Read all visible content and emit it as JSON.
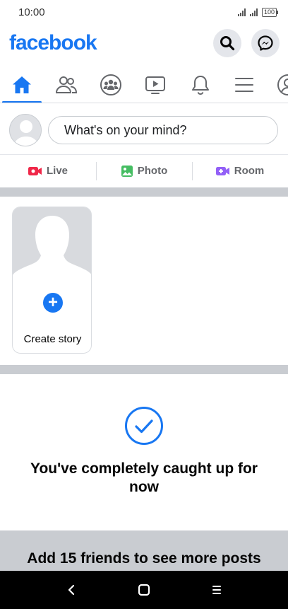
{
  "status_bar": {
    "time": "10:00",
    "battery": "100"
  },
  "header": {
    "logo": "facebook",
    "search_icon": "search-icon",
    "messenger_icon": "messenger-icon"
  },
  "nav_tabs": [
    {
      "name": "home",
      "icon": "home-icon",
      "active": true
    },
    {
      "name": "friends",
      "icon": "friends-icon",
      "active": false
    },
    {
      "name": "groups",
      "icon": "groups-icon",
      "active": false
    },
    {
      "name": "watch",
      "icon": "video-icon",
      "active": false
    },
    {
      "name": "notifications",
      "icon": "bell-icon",
      "active": false
    },
    {
      "name": "menu",
      "icon": "menu-icon",
      "active": false
    },
    {
      "name": "profile",
      "icon": "profile-icon",
      "active": false
    }
  ],
  "composer": {
    "placeholder": "What's on your mind?"
  },
  "composer_actions": [
    {
      "label": "Live",
      "icon": "live-video-icon",
      "color": "#f02849"
    },
    {
      "label": "Photo",
      "icon": "photo-icon",
      "color": "#45bd62"
    },
    {
      "label": "Room",
      "icon": "room-icon",
      "color": "#9360f7"
    }
  ],
  "stories": {
    "create_label": "Create story"
  },
  "feed": {
    "caught_up_title": "You've completely caught up for now",
    "suggest_title": "Add 15 friends to see more posts"
  },
  "colors": {
    "brand": "#1877f2",
    "divider": "#c9ccd1"
  }
}
